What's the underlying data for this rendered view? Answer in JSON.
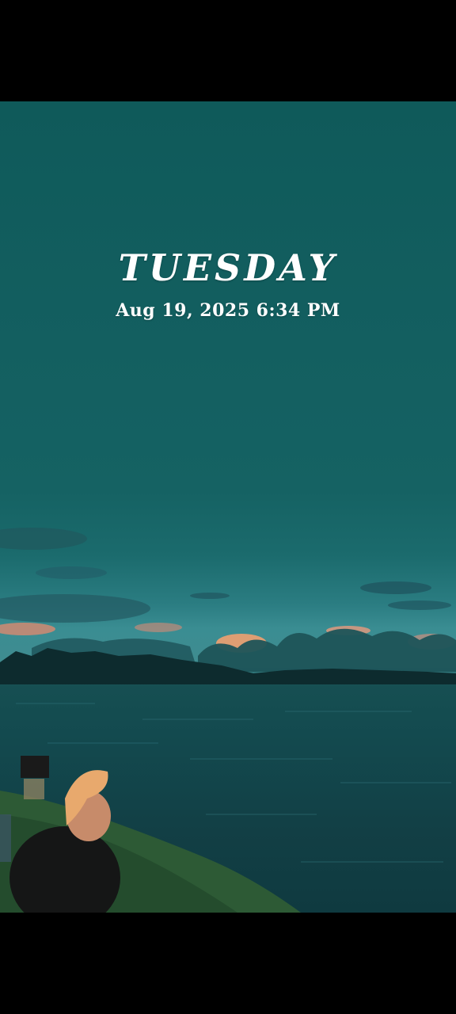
{
  "lockscreen": {
    "day": "TUESDAY",
    "date_time": "Aug 19, 2025 6:34 PM"
  },
  "wallpaper": {
    "description_colors": {
      "sky": "#135f60",
      "horizon_glow": "#f4a07a",
      "water": "#123f45"
    }
  }
}
